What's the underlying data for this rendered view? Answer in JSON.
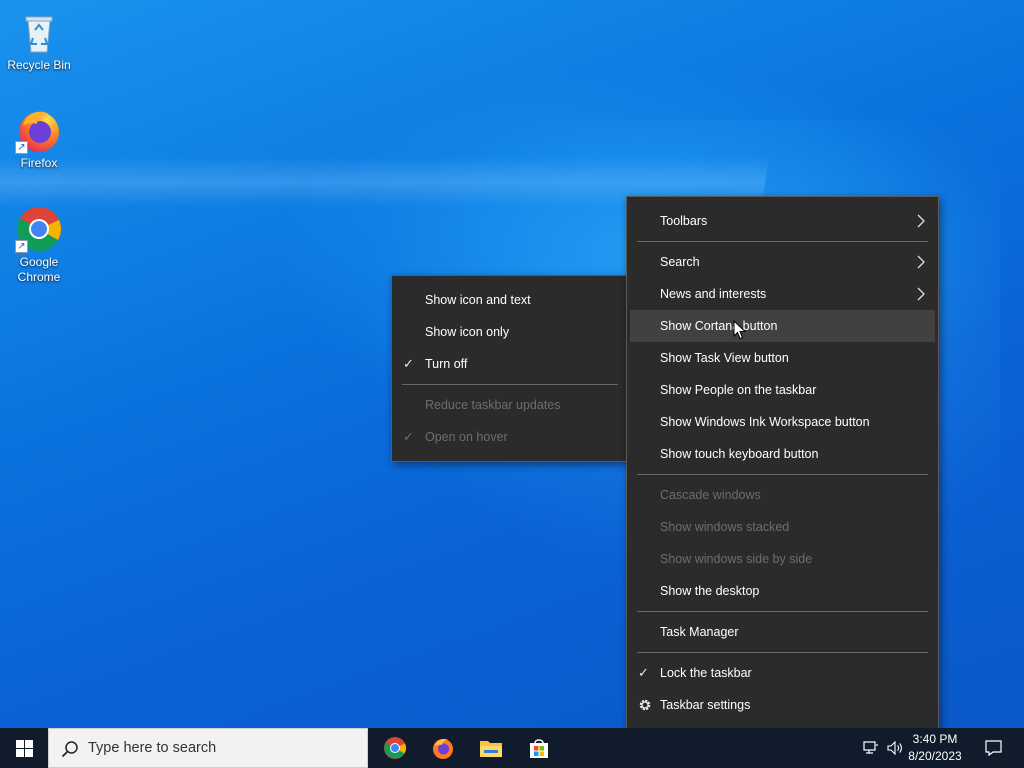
{
  "desktop": {
    "icons": [
      {
        "label": "Recycle Bin",
        "icon": "recycle-bin-icon"
      },
      {
        "label": "Firefox",
        "icon": "firefox-icon"
      },
      {
        "label": "Google Chrome",
        "icon": "chrome-icon"
      }
    ]
  },
  "context_menu": {
    "items": [
      {
        "label": "Toolbars",
        "submenu": true
      },
      {
        "label": "Search",
        "submenu": true
      },
      {
        "label": "News and interests",
        "submenu": true
      },
      {
        "label": "Show Cortana button",
        "hovered": true
      },
      {
        "label": "Show Task View button"
      },
      {
        "label": "Show People on the taskbar"
      },
      {
        "label": "Show Windows Ink Workspace button"
      },
      {
        "label": "Show touch keyboard button"
      },
      {
        "label": "Cascade windows",
        "disabled": true
      },
      {
        "label": "Show windows stacked",
        "disabled": true
      },
      {
        "label": "Show windows side by side",
        "disabled": true
      },
      {
        "label": "Show the desktop"
      },
      {
        "label": "Task Manager"
      },
      {
        "label": "Lock the taskbar",
        "checked": true
      },
      {
        "label": "Taskbar settings",
        "icon": "gear-icon"
      }
    ]
  },
  "submenu_news": {
    "items": [
      {
        "label": "Show icon and text"
      },
      {
        "label": "Show icon only"
      },
      {
        "label": "Turn off",
        "checked": true
      },
      {
        "label": "Reduce taskbar updates",
        "disabled": true
      },
      {
        "label": "Open on hover",
        "disabled": true,
        "checked": true
      }
    ]
  },
  "taskbar": {
    "search_placeholder": "Type here to search",
    "pinned": [
      "chrome-icon",
      "firefox-icon",
      "file-explorer-icon",
      "microsoft-store-icon"
    ],
    "time": "3:40 PM",
    "date": "8/20/2023"
  },
  "colors": {
    "menu_bg": "#2b2b2b",
    "menu_hover": "#414141",
    "taskbar_bg": "#101b2c",
    "desktop_blue": "#0a73de"
  }
}
